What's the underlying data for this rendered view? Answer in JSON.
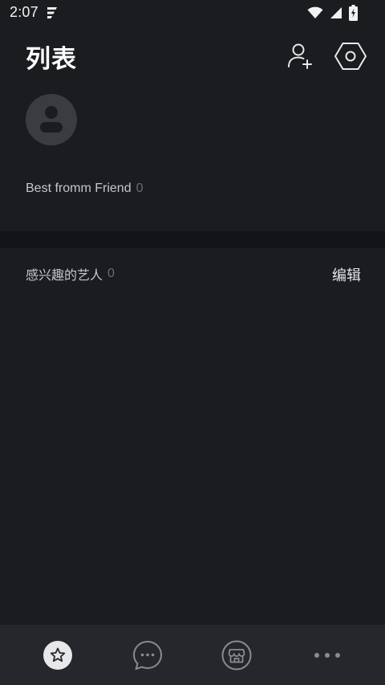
{
  "status_bar": {
    "time": "2:07"
  },
  "header": {
    "title": "列表"
  },
  "best_friend": {
    "label": "Best fromm Friend",
    "count": "0"
  },
  "artists": {
    "label": "感兴趣的艺人",
    "count": "0",
    "edit_label": "编辑"
  },
  "bottom_nav": {
    "items": [
      {
        "icon": "star-icon",
        "active": true
      },
      {
        "icon": "chat-bubble-icon",
        "active": false
      },
      {
        "icon": "shop-icon",
        "active": false
      },
      {
        "icon": "more-icon",
        "active": false
      }
    ]
  },
  "colors": {
    "background": "#1b1c20",
    "divider": "#131417",
    "nav_background": "#26272c",
    "text_primary": "#ffffff",
    "text_secondary": "#c5c6cb",
    "text_muted": "#6a6b70"
  }
}
